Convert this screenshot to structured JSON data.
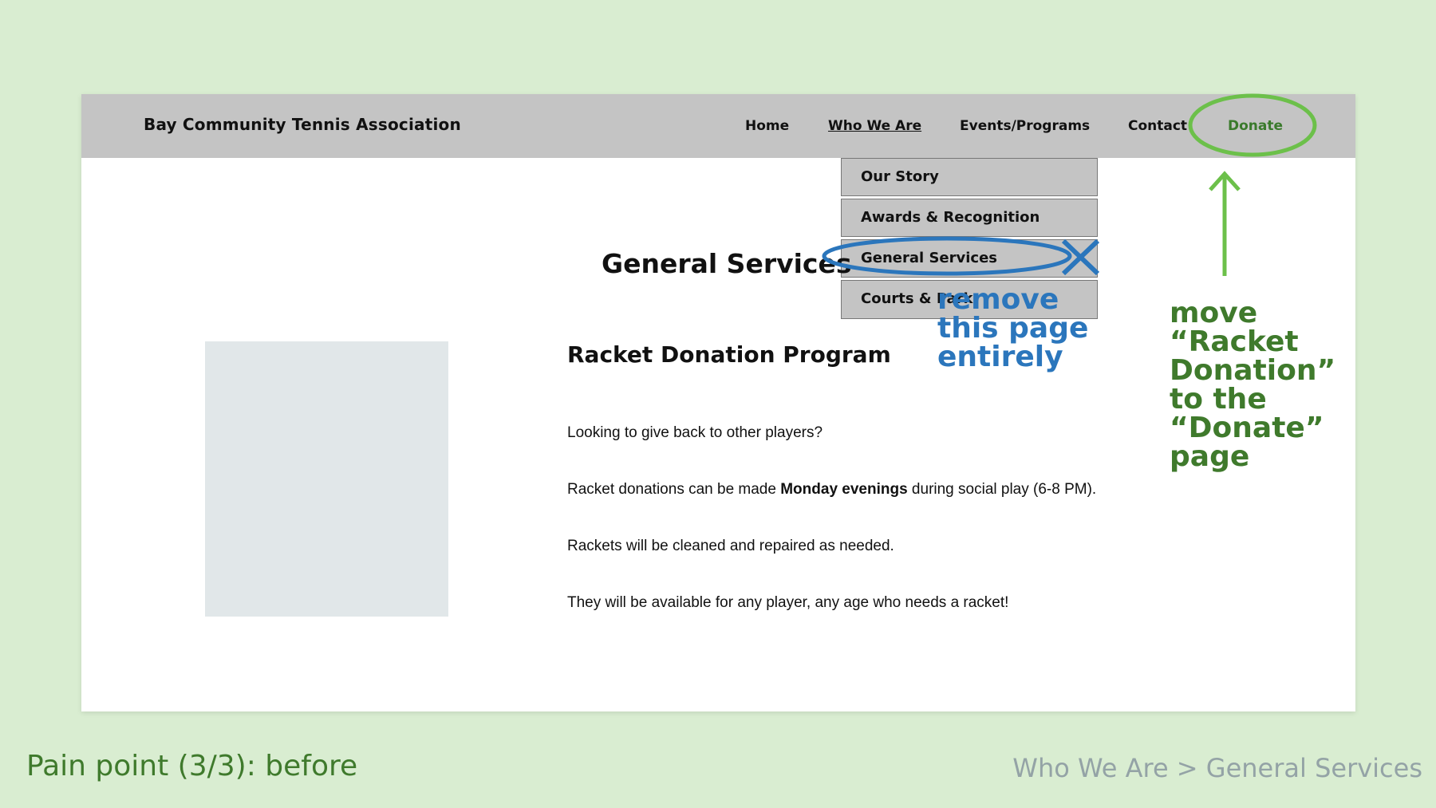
{
  "site": {
    "title": "Bay Community Tennis Association"
  },
  "nav": {
    "home": "Home",
    "who_we_are": "Who We Are",
    "events": "Events/Programs",
    "contact": "Contact",
    "donate": "Donate"
  },
  "dropdown": {
    "items": [
      "Our Story",
      "Awards & Recognition",
      "General Services",
      "Courts & Park"
    ]
  },
  "main": {
    "heading": "General Services",
    "subheading": "Racket Donation Program",
    "para1": "Looking to give back to other players?",
    "para2_prefix": "Racket donations can be made ",
    "para2_bold": "Monday evenings",
    "para2_suffix": " during social play (6-8 PM).",
    "para3": "Rackets will be cleaned and repaired as needed.",
    "para4": "They will be available for any player, any age who needs a racket!"
  },
  "annotations": {
    "blue_lines": [
      "remove",
      "this page",
      "entirely"
    ],
    "green_lines": [
      "move",
      "“Racket",
      "Donation”",
      "to the",
      "“Donate”",
      "page"
    ],
    "blue_color": "#2b76bc",
    "green_color": "#6cc04a"
  },
  "footer": {
    "left": "Pain point (3/3): before",
    "right": "Who We Are > General Services"
  },
  "colors": {
    "background": "#d9edd1",
    "navbar": "#c4c4c4",
    "accent_green": "#3f7a2c",
    "footer_gray": "#94a3a6"
  }
}
